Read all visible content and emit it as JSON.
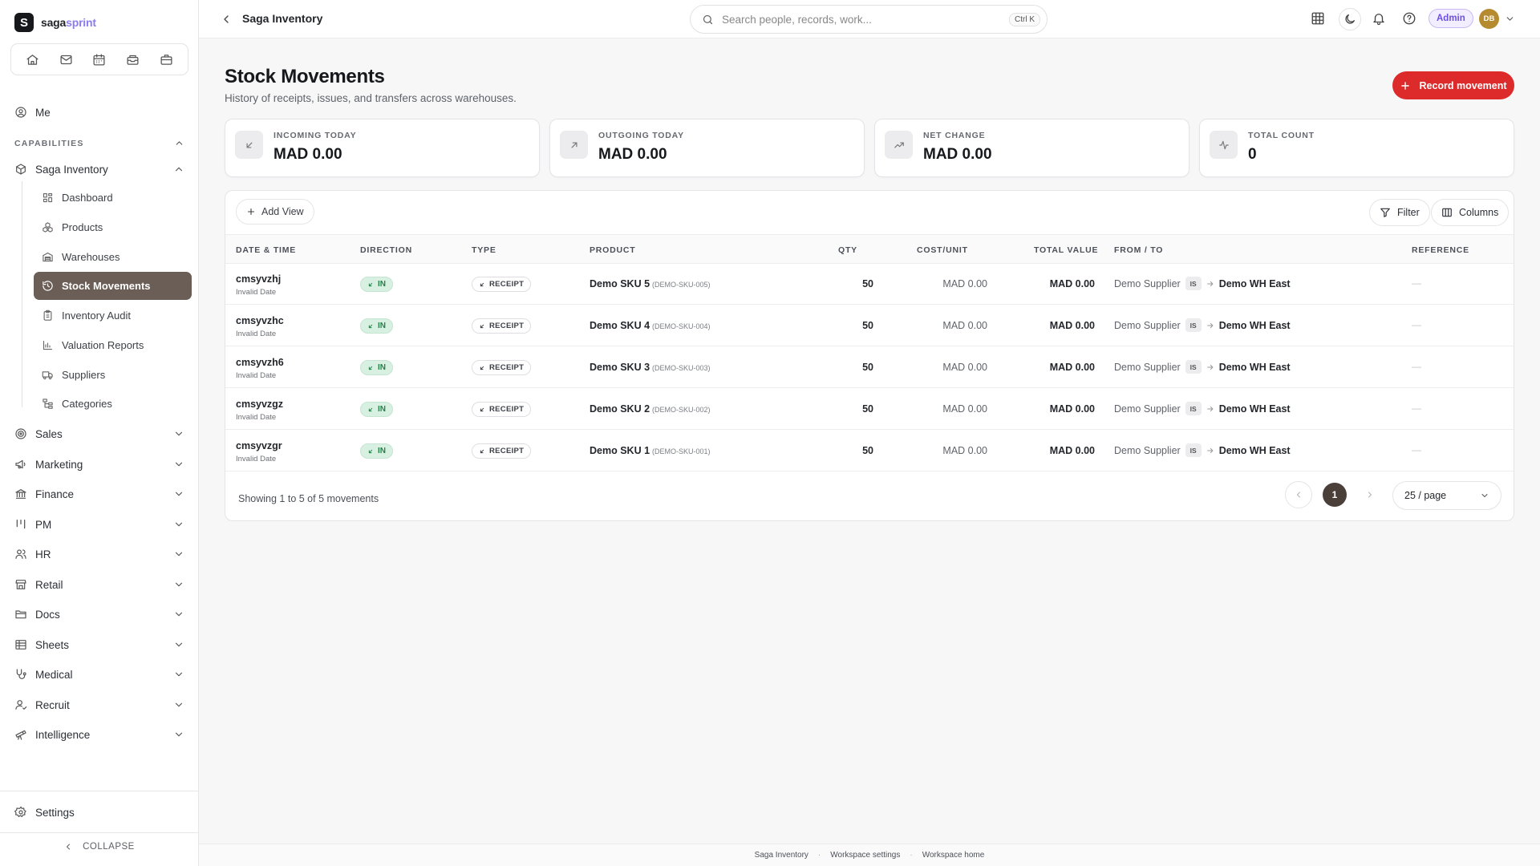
{
  "brand": {
    "logo_letter": "S",
    "name_part1": "saga",
    "name_part2": "sprint"
  },
  "quick_icons": [
    "home-icon",
    "mail-icon",
    "calendar-icon",
    "inbox-icon",
    "briefcase-icon"
  ],
  "sidebar": {
    "me": "Me",
    "capabilities_label": "CAPABILITIES",
    "active_group": "Saga Inventory",
    "sub_items": [
      {
        "label": "Dashboard",
        "icon": "dashboard-icon"
      },
      {
        "label": "Products",
        "icon": "boxes-icon"
      },
      {
        "label": "Warehouses",
        "icon": "warehouse-icon"
      },
      {
        "label": "Stock Movements",
        "icon": "history-icon"
      },
      {
        "label": "Inventory Audit",
        "icon": "clipboard-icon"
      },
      {
        "label": "Valuation Reports",
        "icon": "bar-chart-icon"
      },
      {
        "label": "Suppliers",
        "icon": "truck-icon"
      },
      {
        "label": "Categories",
        "icon": "tree-icon"
      }
    ],
    "groups": [
      {
        "label": "Sales",
        "icon": "sales-icon"
      },
      {
        "label": "Marketing",
        "icon": "megaphone-icon"
      },
      {
        "label": "Finance",
        "icon": "bank-icon"
      },
      {
        "label": "PM",
        "icon": "kanban-icon"
      },
      {
        "label": "HR",
        "icon": "users-icon"
      },
      {
        "label": "Retail",
        "icon": "store-icon"
      },
      {
        "label": "Docs",
        "icon": "folder-icon"
      },
      {
        "label": "Sheets",
        "icon": "sheet-icon"
      },
      {
        "label": "Medical",
        "icon": "stethoscope-icon"
      },
      {
        "label": "Recruit",
        "icon": "recruit-icon"
      },
      {
        "label": "Intelligence",
        "icon": "telescope-icon"
      }
    ],
    "settings": "Settings",
    "collapse": "COLLAPSE"
  },
  "topbar": {
    "breadcrumb": "Saga Inventory",
    "search_placeholder": "Search people, records, work...",
    "search_shortcut": "Ctrl K",
    "admin_label": "Admin",
    "avatar_initials": "DB"
  },
  "page": {
    "title": "Stock Movements",
    "subtitle": "History of receipts, issues, and transfers across warehouses.",
    "record_button": "Record movement"
  },
  "stats": [
    {
      "label": "INCOMING TODAY",
      "value": "MAD 0.00",
      "icon": "arrow-down-left-icon"
    },
    {
      "label": "OUTGOING TODAY",
      "value": "MAD 0.00",
      "icon": "arrow-up-right-icon"
    },
    {
      "label": "NET CHANGE",
      "value": "MAD 0.00",
      "icon": "trending-up-icon"
    },
    {
      "label": "TOTAL COUNT",
      "value": "0",
      "icon": "activity-icon"
    }
  ],
  "table": {
    "add_view": "Add View",
    "filter": "Filter",
    "columns_btn": "Columns",
    "columns": [
      "DATE & TIME",
      "DIRECTION",
      "TYPE",
      "PRODUCT",
      "QTY",
      "COST/UNIT",
      "TOTAL VALUE",
      "FROM / TO",
      "REFERENCE"
    ],
    "rows": [
      {
        "id": "cmsyvzhj",
        "date": "Invalid Date",
        "direction": "IN",
        "type": "RECEIPT",
        "product": "Demo SKU 5",
        "sku": "(DEMO-SKU-005)",
        "qty": "50",
        "cost": "MAD 0.00",
        "total": "MAD 0.00",
        "from": "Demo Supplier",
        "from_badge": "IS",
        "to": "Demo WH East",
        "reference": "—"
      },
      {
        "id": "cmsyvzhc",
        "date": "Invalid Date",
        "direction": "IN",
        "type": "RECEIPT",
        "product": "Demo SKU 4",
        "sku": "(DEMO-SKU-004)",
        "qty": "50",
        "cost": "MAD 0.00",
        "total": "MAD 0.00",
        "from": "Demo Supplier",
        "from_badge": "IS",
        "to": "Demo WH East",
        "reference": "—"
      },
      {
        "id": "cmsyvzh6",
        "date": "Invalid Date",
        "direction": "IN",
        "type": "RECEIPT",
        "product": "Demo SKU 3",
        "sku": "(DEMO-SKU-003)",
        "qty": "50",
        "cost": "MAD 0.00",
        "total": "MAD 0.00",
        "from": "Demo Supplier",
        "from_badge": "IS",
        "to": "Demo WH East",
        "reference": "—"
      },
      {
        "id": "cmsyvzgz",
        "date": "Invalid Date",
        "direction": "IN",
        "type": "RECEIPT",
        "product": "Demo SKU 2",
        "sku": "(DEMO-SKU-002)",
        "qty": "50",
        "cost": "MAD 0.00",
        "total": "MAD 0.00",
        "from": "Demo Supplier",
        "from_badge": "IS",
        "to": "Demo WH East",
        "reference": "—"
      },
      {
        "id": "cmsyvzgr",
        "date": "Invalid Date",
        "direction": "IN",
        "type": "RECEIPT",
        "product": "Demo SKU 1",
        "sku": "(DEMO-SKU-001)",
        "qty": "50",
        "cost": "MAD 0.00",
        "total": "MAD 0.00",
        "from": "Demo Supplier",
        "from_badge": "IS",
        "to": "Demo WH East",
        "reference": "—"
      }
    ],
    "footer_text": "Showing 1 to 5 of 5 movements",
    "current_page": "1",
    "per_page": "25 / page"
  },
  "footer": {
    "links": [
      "Saga Inventory",
      "Workspace settings",
      "Workspace home"
    ]
  },
  "colors": {
    "primary": "#dd2b2b",
    "active_nav": "#6b5e57",
    "admin": "#6c4fe0",
    "in_badge": "#26804a",
    "avatar": "#b68a2e"
  }
}
